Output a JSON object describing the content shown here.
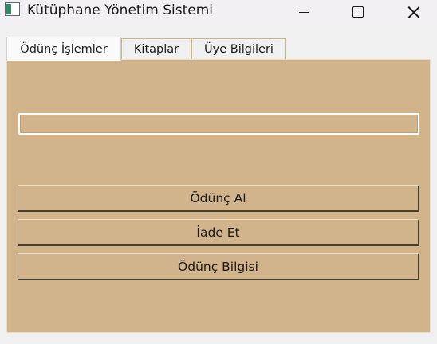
{
  "window": {
    "title": "Kütüphane Yönetim Sistemi",
    "icon": "tk-app-icon"
  },
  "tabs": [
    {
      "label": "Ödünç İşlemler",
      "active": true
    },
    {
      "label": "Kitaplar",
      "active": false
    },
    {
      "label": "Üye Bilgileri",
      "active": false
    }
  ],
  "panel": {
    "background": "#d2b48c",
    "input_value": "",
    "buttons": [
      {
        "label": "Ödünç Al"
      },
      {
        "label": "İade Et"
      },
      {
        "label": "Ödünç Bilgisi"
      }
    ]
  }
}
